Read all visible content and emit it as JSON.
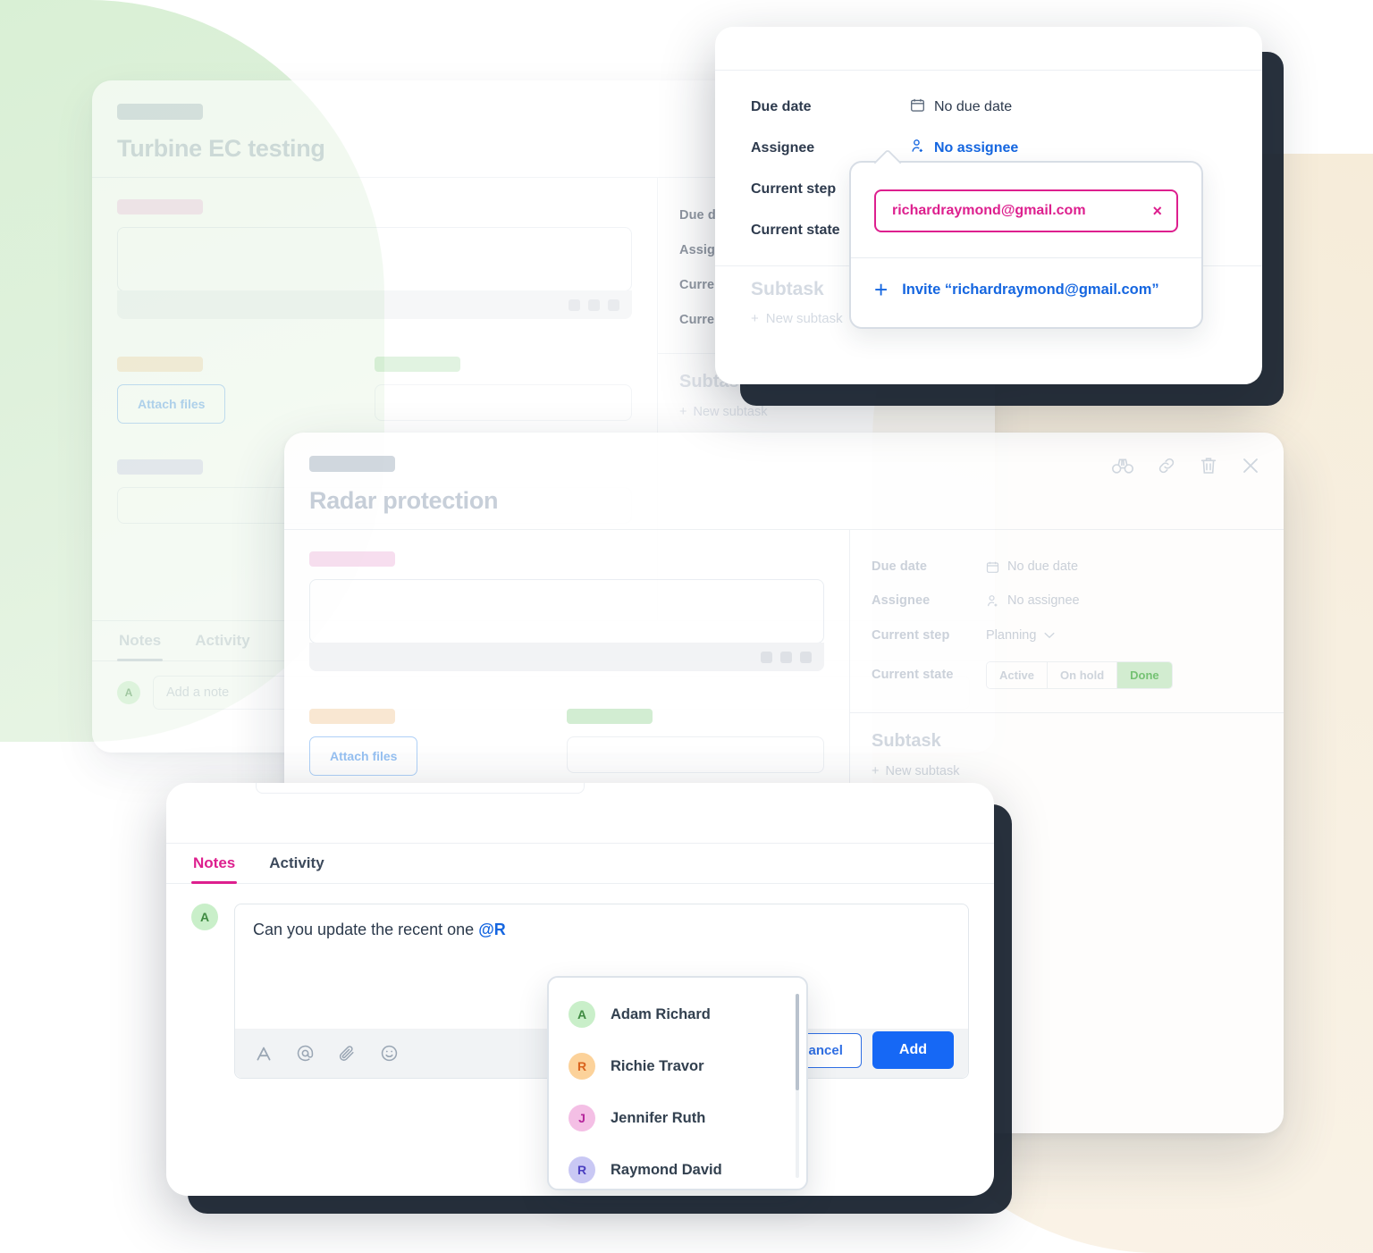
{
  "background": {
    "blob_green": "#dff1dc",
    "blob_cream": "#f7efe0"
  },
  "cards": {
    "turbine": {
      "title": "Turbine EC testing",
      "attach_button": "Attach files",
      "meta": {
        "due_date_label": "Due date",
        "assignee_label": "Assignee",
        "current_step_label": "Current  step",
        "current_state_label": "Current  state",
        "subtask_heading": "Subtask",
        "new_subtask": "New subtask"
      },
      "tabs": {
        "notes": "Notes",
        "activity": "Activity"
      },
      "note_placeholder": "Add a note",
      "avatar_initial": "A"
    },
    "radar": {
      "title": "Radar protection",
      "attach_button": "Attach files",
      "head_icons": [
        "binoculars-icon",
        "link-icon",
        "trash-icon",
        "close-icon"
      ],
      "meta": {
        "due_date_label": "Due date",
        "due_date_value": "No due date",
        "assignee_label": "Assignee",
        "assignee_value": "No assignee",
        "current_step_label": "Current  step",
        "current_step_value": "Planning",
        "current_state_label": "Current  state",
        "state_options": [
          "Active",
          "On hold",
          "Done"
        ],
        "state_selected": "Done",
        "subtask_heading": "Subtask",
        "new_subtask": "New subtask"
      }
    },
    "assignee_panel": {
      "due_date_label": "Due date",
      "due_date_value": "No due date",
      "assignee_label": "Assignee",
      "assignee_value": "No assignee",
      "current_step_label": "Current  step",
      "current_state_label": "Current  state",
      "subtask_heading": "Subtask",
      "new_subtask": "New subtask",
      "invite": {
        "email": "richardraymond@gmail.com",
        "clear_icon": "×",
        "invite_label": "Invite “richardraymond@gmail.com”"
      }
    },
    "notes": {
      "tabs": {
        "notes": "Notes",
        "activity": "Activity"
      },
      "avatar_initial": "A",
      "note_text": "Can you update the recent one ",
      "note_mention": "@R",
      "toolbar_icons": [
        "text-format-icon",
        "mention-icon",
        "attachment-icon",
        "emoji-icon"
      ],
      "cancel_label": "Cancel",
      "add_label": "Add",
      "mention_list": [
        {
          "initial": "A",
          "name": "Adam Richard",
          "color": "green"
        },
        {
          "initial": "R",
          "name": "Richie Travor",
          "color": "orange"
        },
        {
          "initial": "J",
          "name": "Jennifer Ruth",
          "color": "pink"
        },
        {
          "initial": "R",
          "name": "Raymond  David",
          "color": "purple"
        }
      ]
    }
  },
  "colors": {
    "accent_pink": "#dd1f8e",
    "accent_blue": "#1668f5",
    "done_green": "#6abf6a"
  }
}
